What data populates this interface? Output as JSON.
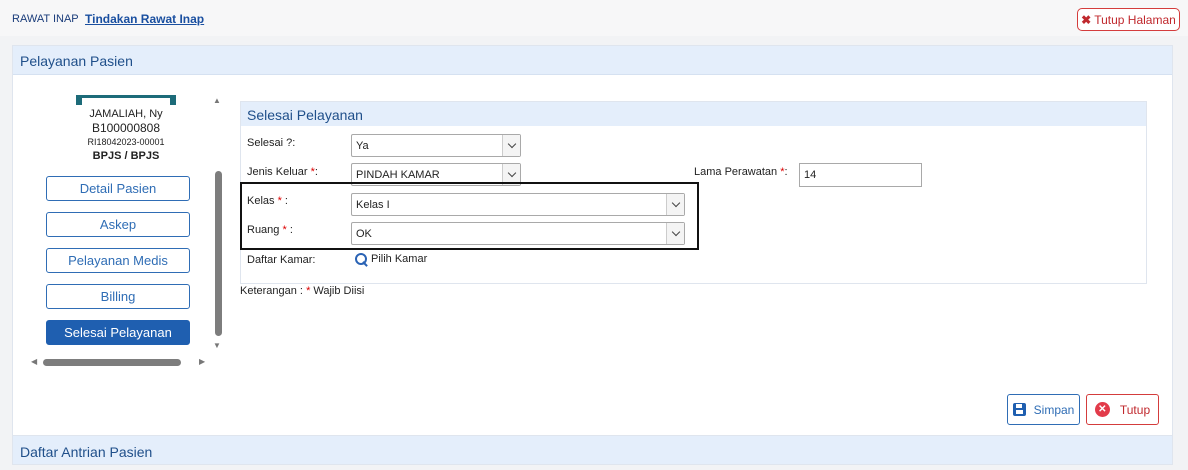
{
  "breadcrumb": {
    "root": "RAWAT INAP",
    "current": "Tindakan Rawat Inap"
  },
  "header": {
    "close_page_label": "Tutup Halaman"
  },
  "panel": {
    "title": "Pelayanan Pasien"
  },
  "patient": {
    "name": "JAMALIAH, Ny",
    "id": "B100000808",
    "registration": "RI18042023-00001",
    "insurance": "BPJS / BPJS"
  },
  "nav": {
    "items": [
      {
        "label": "Detail Pasien"
      },
      {
        "label": "Askep"
      },
      {
        "label": "Pelayanan Medis"
      },
      {
        "label": "Billing"
      },
      {
        "label": "Selesai Pelayanan"
      }
    ],
    "active": "Selesai Pelayanan"
  },
  "section": {
    "title": "Selesai Pelayanan"
  },
  "form": {
    "selesai": {
      "label": "Selesai ?:",
      "value": "Ya"
    },
    "jenis_keluar": {
      "label": "Jenis Keluar",
      "value": "PINDAH KAMAR"
    },
    "lama_perawatan": {
      "label": "Lama Perawatan",
      "value": "14"
    },
    "kelas": {
      "label": "Kelas",
      "value": "Kelas I"
    },
    "ruang": {
      "label": "Ruang",
      "value": "OK"
    },
    "daftar_kamar": {
      "label": "Daftar Kamar:",
      "link": "Pilih Kamar"
    },
    "required_mark": "*",
    "colon": ":",
    "colon_spaced": " :"
  },
  "note": {
    "text": "Keterangan : ",
    "required": "*",
    "suffix": " Wajib Diisi"
  },
  "actions": {
    "save_label": "Simpan",
    "close_label": "Tutup"
  },
  "queue": {
    "title": "Daftar Antrian Pasien"
  },
  "colors": {
    "accent": "#1f5fb0",
    "danger": "#d43c3c",
    "header_bg": "#e4eefb"
  },
  "icons": {
    "close_page": "close-icon",
    "search": "search-icon",
    "save": "save-icon",
    "cancel": "cancel-icon"
  }
}
